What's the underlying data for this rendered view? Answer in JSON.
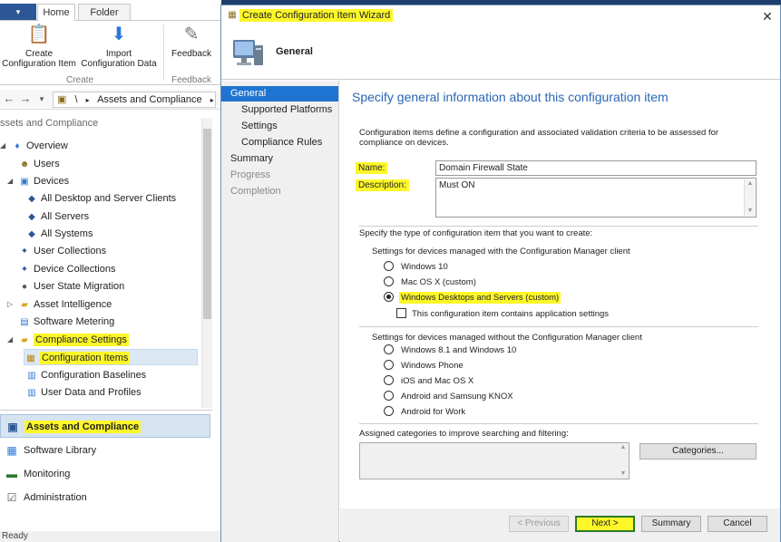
{
  "console": {
    "tabs": {
      "home": "Home",
      "folder": "Folder"
    },
    "ribbon": {
      "create_ci": "Create\nConfiguration Item",
      "import_cd": "Import\nConfiguration Data",
      "feedback": "Feedback",
      "group_create": "Create",
      "group_feedback": "Feedback"
    },
    "breadcrumb": {
      "sep": "\\",
      "sep2": "▸",
      "label": "Assets and Compliance",
      "more": "▸"
    },
    "workspace_header": "ssets and Compliance",
    "tree": [
      {
        "label": "Overview"
      },
      {
        "label": "Users"
      },
      {
        "label": "Devices"
      },
      {
        "label": "All Desktop and Server Clients"
      },
      {
        "label": "All Servers"
      },
      {
        "label": "All Systems"
      },
      {
        "label": "User Collections"
      },
      {
        "label": "Device Collections"
      },
      {
        "label": "User State Migration"
      },
      {
        "label": "Asset Intelligence"
      },
      {
        "label": "Software Metering"
      },
      {
        "label": "Compliance Settings"
      },
      {
        "label": "Configuration Items"
      },
      {
        "label": "Configuration Baselines"
      },
      {
        "label": "User Data and Profiles"
      }
    ],
    "wunderbar": [
      {
        "label": "Assets and Compliance"
      },
      {
        "label": "Software Library"
      },
      {
        "label": "Monitoring"
      },
      {
        "label": "Administration"
      }
    ],
    "status": "Ready",
    "highlight_color": "#fdf72a"
  },
  "wizard": {
    "title": "Create Configuration Item Wizard",
    "close": "✕",
    "header_title": "General",
    "steps": [
      {
        "label": "General",
        "state": "active"
      },
      {
        "label": "Supported Platforms",
        "state": "normal"
      },
      {
        "label": "Settings",
        "state": "normal"
      },
      {
        "label": "Compliance Rules",
        "state": "normal"
      },
      {
        "label": "Summary",
        "state": "normal"
      },
      {
        "label": "Progress",
        "state": "disabled"
      },
      {
        "label": "Completion",
        "state": "disabled"
      }
    ],
    "heading": "Specify general information about this configuration item",
    "intro": "Configuration items define a configuration and associated validation criteria to be assessed for compliance on devices.",
    "name_label": "Name:",
    "name_value": "Domain Firewall State",
    "description_label": "Description:",
    "description_value": "Must ON",
    "type_label": "Specify the type of configuration item that you want to create:",
    "managed_group": "Settings for devices managed with the Configuration Manager client",
    "managed_options": [
      {
        "label": "Windows 10",
        "checked": false
      },
      {
        "label": "Mac OS X (custom)",
        "checked": false
      },
      {
        "label": "Windows Desktops and Servers (custom)",
        "checked": true
      }
    ],
    "app_settings_check": "This configuration item contains application settings",
    "unmanaged_group": "Settings for devices managed without the Configuration Manager client",
    "unmanaged_options": [
      {
        "label": "Windows 8.1 and Windows 10"
      },
      {
        "label": "Windows Phone"
      },
      {
        "label": "iOS and Mac OS X"
      },
      {
        "label": "Android and Samsung KNOX"
      },
      {
        "label": "Android for Work"
      }
    ],
    "categories_label": "Assigned categories to improve searching and filtering:",
    "categories_button": "Categories...",
    "buttons": {
      "previous": "< Previous",
      "next": "Next >",
      "summary": "Summary",
      "cancel": "Cancel"
    },
    "accent_color": "#1e74d0",
    "heading_color": "#2a66b5"
  }
}
